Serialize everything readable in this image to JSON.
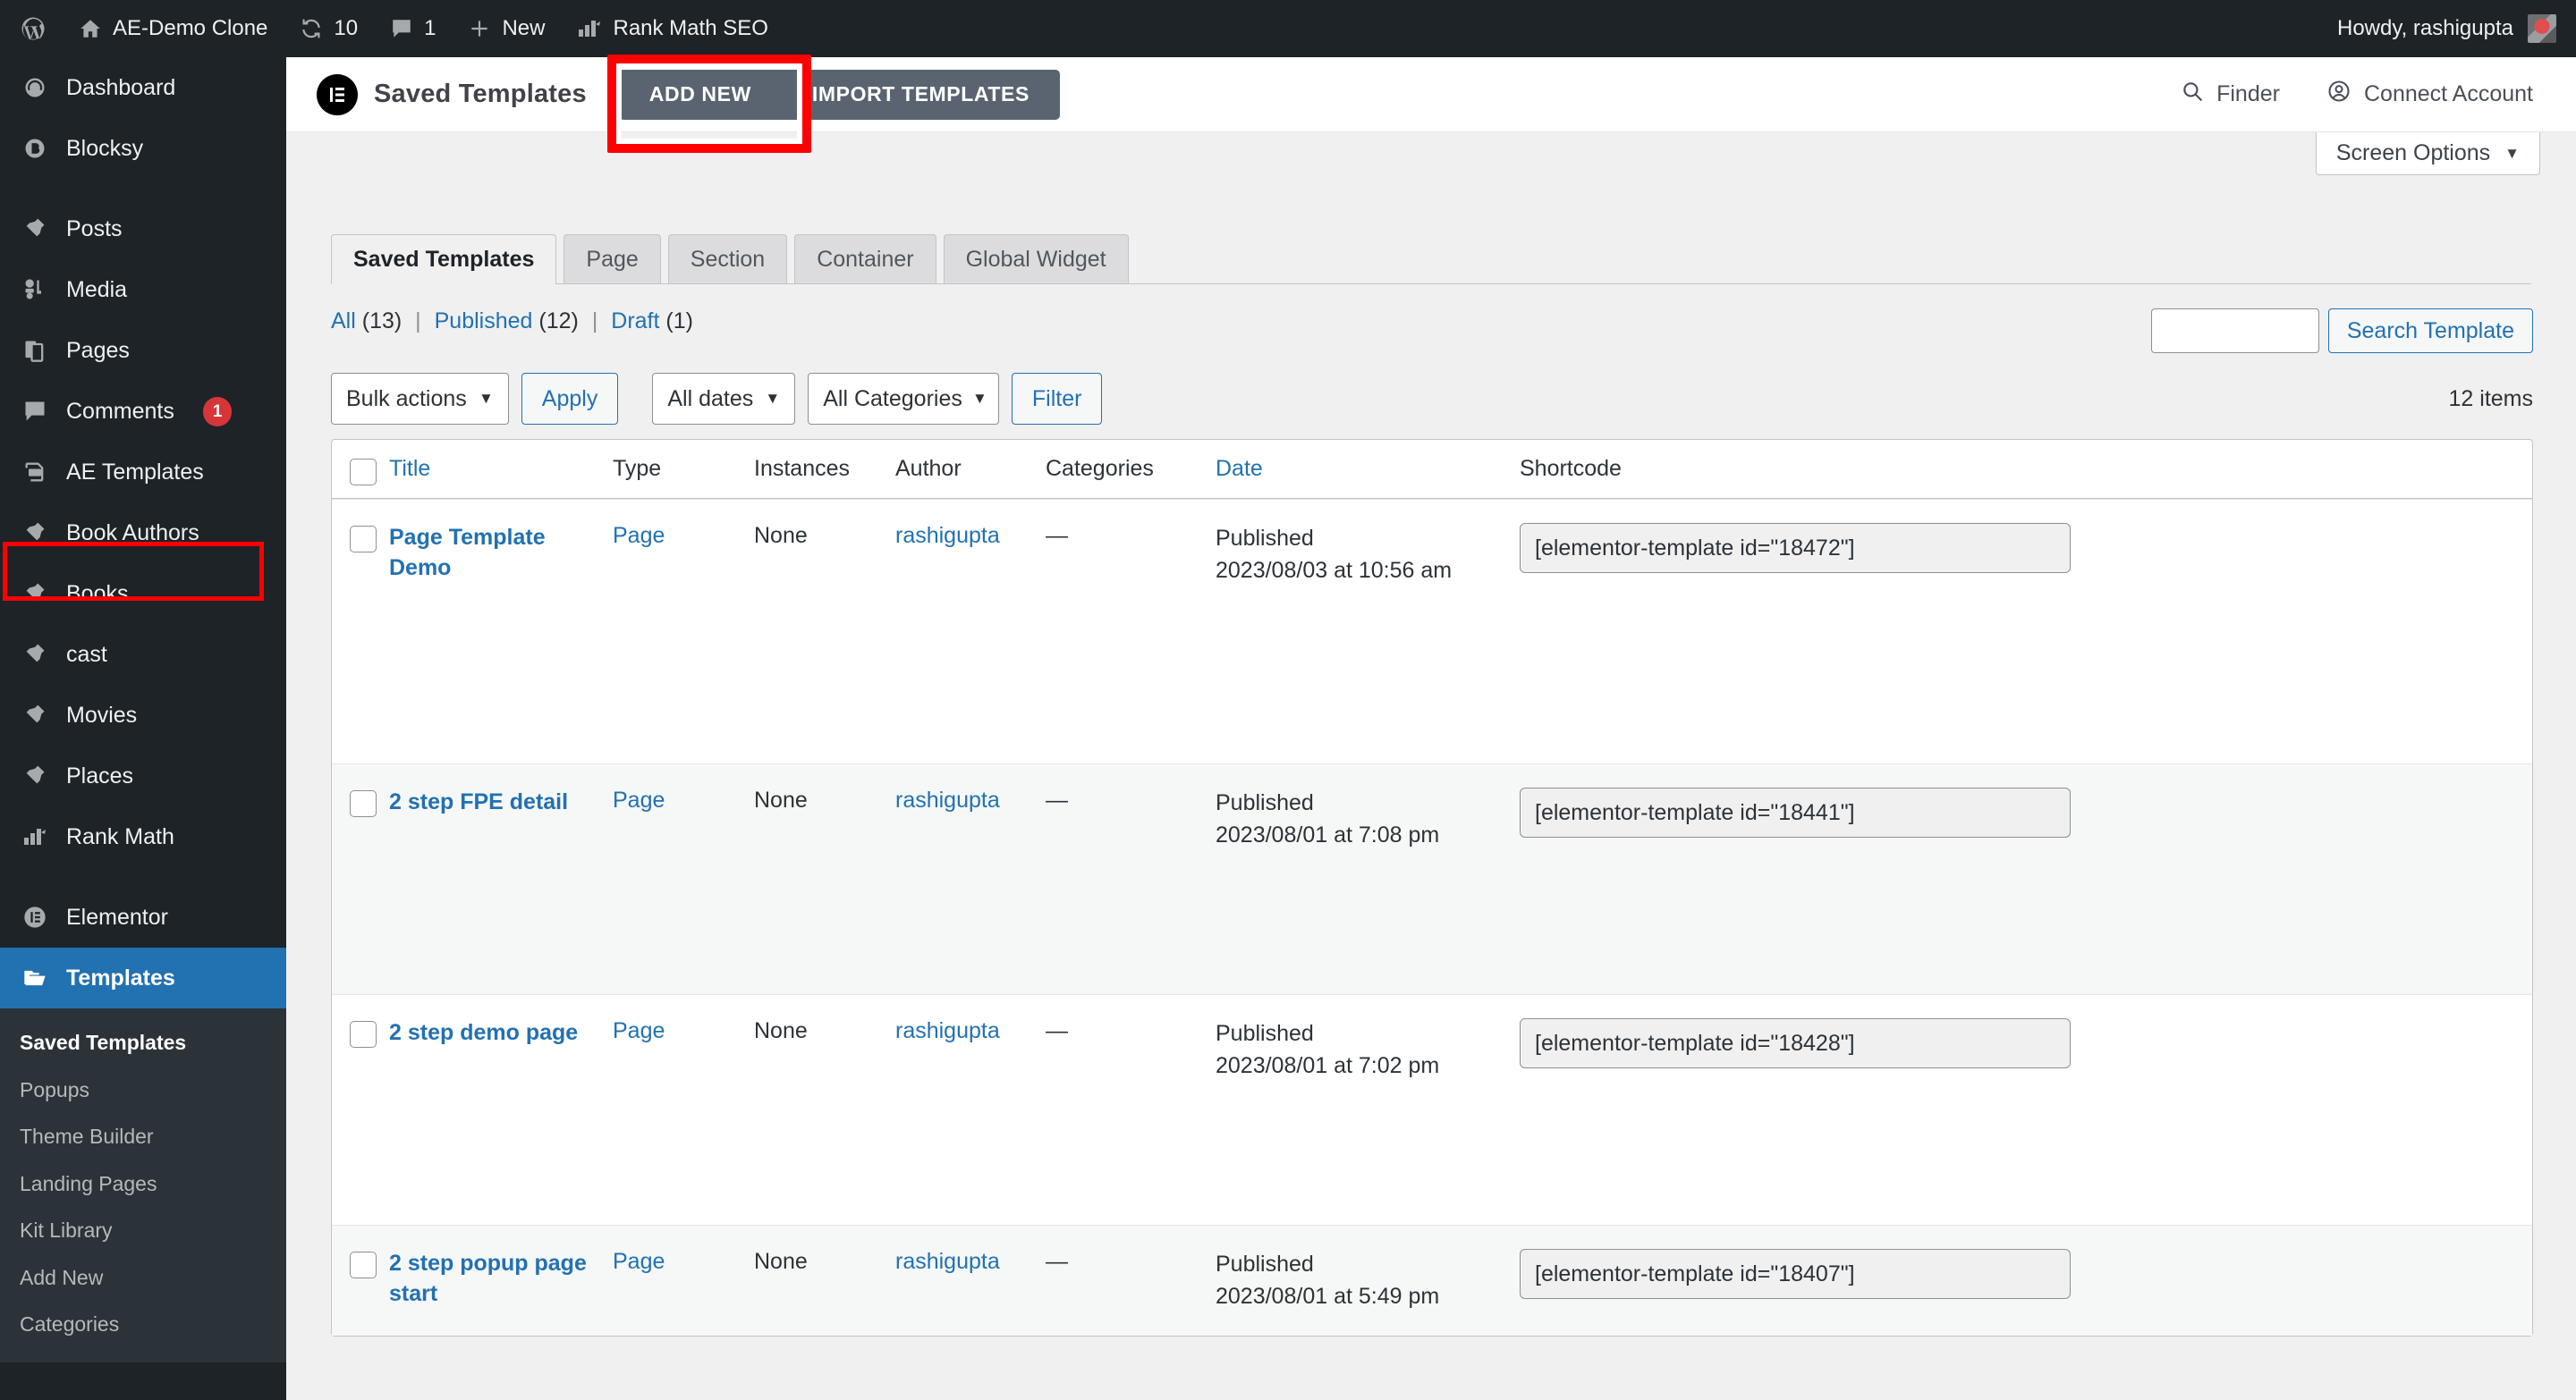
{
  "adminbar": {
    "wp_logo": "wordpress-logo",
    "site_name": "AE-Demo Clone",
    "updates_count": "10",
    "comments_count": "1",
    "new_label": "New",
    "rank_math_label": "Rank Math SEO",
    "howdy": "Howdy, rashigupta"
  },
  "sidebar": {
    "items": [
      {
        "label": "Dashboard",
        "icon": "dashboard-icon"
      },
      {
        "label": "Blocksy",
        "icon": "blocksy-icon"
      },
      {
        "label": "Posts",
        "icon": "pin-icon"
      },
      {
        "label": "Media",
        "icon": "media-icon"
      },
      {
        "label": "Pages",
        "icon": "pages-icon"
      },
      {
        "label": "Comments",
        "icon": "comments-icon",
        "badge": "1"
      },
      {
        "label": "AE Templates",
        "icon": "ae-templates-icon"
      },
      {
        "label": "Book Authors",
        "icon": "pin-icon"
      },
      {
        "label": "Books",
        "icon": "pin-icon"
      },
      {
        "label": "cast",
        "icon": "pin-icon"
      },
      {
        "label": "Movies",
        "icon": "pin-icon"
      },
      {
        "label": "Places",
        "icon": "pin-icon"
      },
      {
        "label": "Rank Math",
        "icon": "rank-math-icon"
      },
      {
        "label": "Elementor",
        "icon": "elementor-icon"
      },
      {
        "label": "Templates",
        "icon": "folder-icon",
        "current": true
      }
    ],
    "submenu": [
      {
        "label": "Saved Templates",
        "current": true
      },
      {
        "label": "Popups"
      },
      {
        "label": "Theme Builder"
      },
      {
        "label": "Landing Pages"
      },
      {
        "label": "Kit Library"
      },
      {
        "label": "Add New"
      },
      {
        "label": "Categories"
      }
    ],
    "highlight_color": "#ff0000",
    "current_bg": "#2271b1"
  },
  "elementor_bar": {
    "title": "Saved Templates",
    "add_new_label": "ADD NEW",
    "import_label": "IMPORT TEMPLATES",
    "finder_label": "Finder",
    "connect_label": "Connect Account",
    "highlight_color": "#ff0000"
  },
  "screen_options": {
    "label": "Screen Options",
    "caret": "▼"
  },
  "tabs": [
    {
      "label": "Saved Templates",
      "active": true
    },
    {
      "label": "Page"
    },
    {
      "label": "Section"
    },
    {
      "label": "Container"
    },
    {
      "label": "Global Widget"
    }
  ],
  "status_links": {
    "all_label": "All",
    "all_count": "(13)",
    "published_label": "Published",
    "published_count": "(12)",
    "draft_label": "Draft",
    "draft_count": "(1)",
    "separator": "|"
  },
  "search": {
    "value": "",
    "placeholder": "",
    "button_label": "Search Template"
  },
  "tablenav": {
    "bulk_actions": "Bulk actions",
    "apply_label": "Apply",
    "all_dates": "All dates",
    "all_categories": "All Categories",
    "filter_label": "Filter",
    "items_count": "12 items"
  },
  "table": {
    "columns": [
      "Title",
      "Type",
      "Instances",
      "Author",
      "Categories",
      "Date",
      "Shortcode"
    ],
    "rows": [
      {
        "title": "Page Template Demo",
        "type": "Page",
        "instances": "None",
        "author": "rashigupta",
        "categories": "—",
        "date_status": "Published",
        "date_value": "2023/08/03 at 10:56 am",
        "shortcode": "[elementor-template id=\"18472\"]"
      },
      {
        "title": "2 step FPE detail",
        "type": "Page",
        "instances": "None",
        "author": "rashigupta",
        "categories": "—",
        "date_status": "Published",
        "date_value": "2023/08/01 at 7:08 pm",
        "shortcode": "[elementor-template id=\"18441\"]"
      },
      {
        "title": "2 step demo page",
        "type": "Page",
        "instances": "None",
        "author": "rashigupta",
        "categories": "—",
        "date_status": "Published",
        "date_value": "2023/08/01 at 7:02 pm",
        "shortcode": "[elementor-template id=\"18428\"]"
      },
      {
        "title": "2 step popup page start",
        "type": "Page",
        "instances": "None",
        "author": "rashigupta",
        "categories": "—",
        "date_status": "Published",
        "date_value": "2023/08/01 at 5:49 pm",
        "shortcode": "[elementor-template id=\"18407\"]"
      }
    ]
  }
}
